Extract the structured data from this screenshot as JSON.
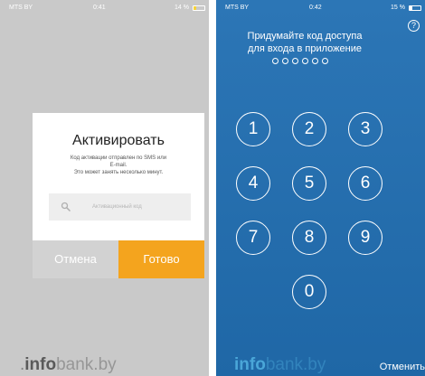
{
  "left_screen": {
    "status_bar": {
      "carrier": "MTS BY",
      "time": "0:41",
      "battery": "14 %"
    },
    "dialog": {
      "title": "Активировать",
      "message_line1": "Код активации отправлен по SMS или",
      "message_line2": "E-mail.",
      "message_line3": "Это может занять несколько минут.",
      "input_placeholder": "Активационный код",
      "cancel_label": "Отмена",
      "done_label": "Готово"
    },
    "watermark": {
      "main": "info",
      "faded": "bank.by"
    }
  },
  "right_screen": {
    "status_bar": {
      "carrier": "MTS BY",
      "time": "0:42",
      "battery": "15 %"
    },
    "help_label": "?",
    "prompt_line1": "Придумайте код доступа",
    "prompt_line2": "для входа в приложение",
    "code_length": 6,
    "keypad": [
      "1",
      "2",
      "3",
      "4",
      "5",
      "6",
      "7",
      "8",
      "9",
      "0"
    ],
    "cancel_label": "Отменить",
    "watermark": {
      "main": "info",
      "faded": "bank.by"
    }
  },
  "colors": {
    "accent_orange": "#f4a41e",
    "pin_background": "#2c76b6",
    "overlay_gray": "#c9c9c9"
  }
}
